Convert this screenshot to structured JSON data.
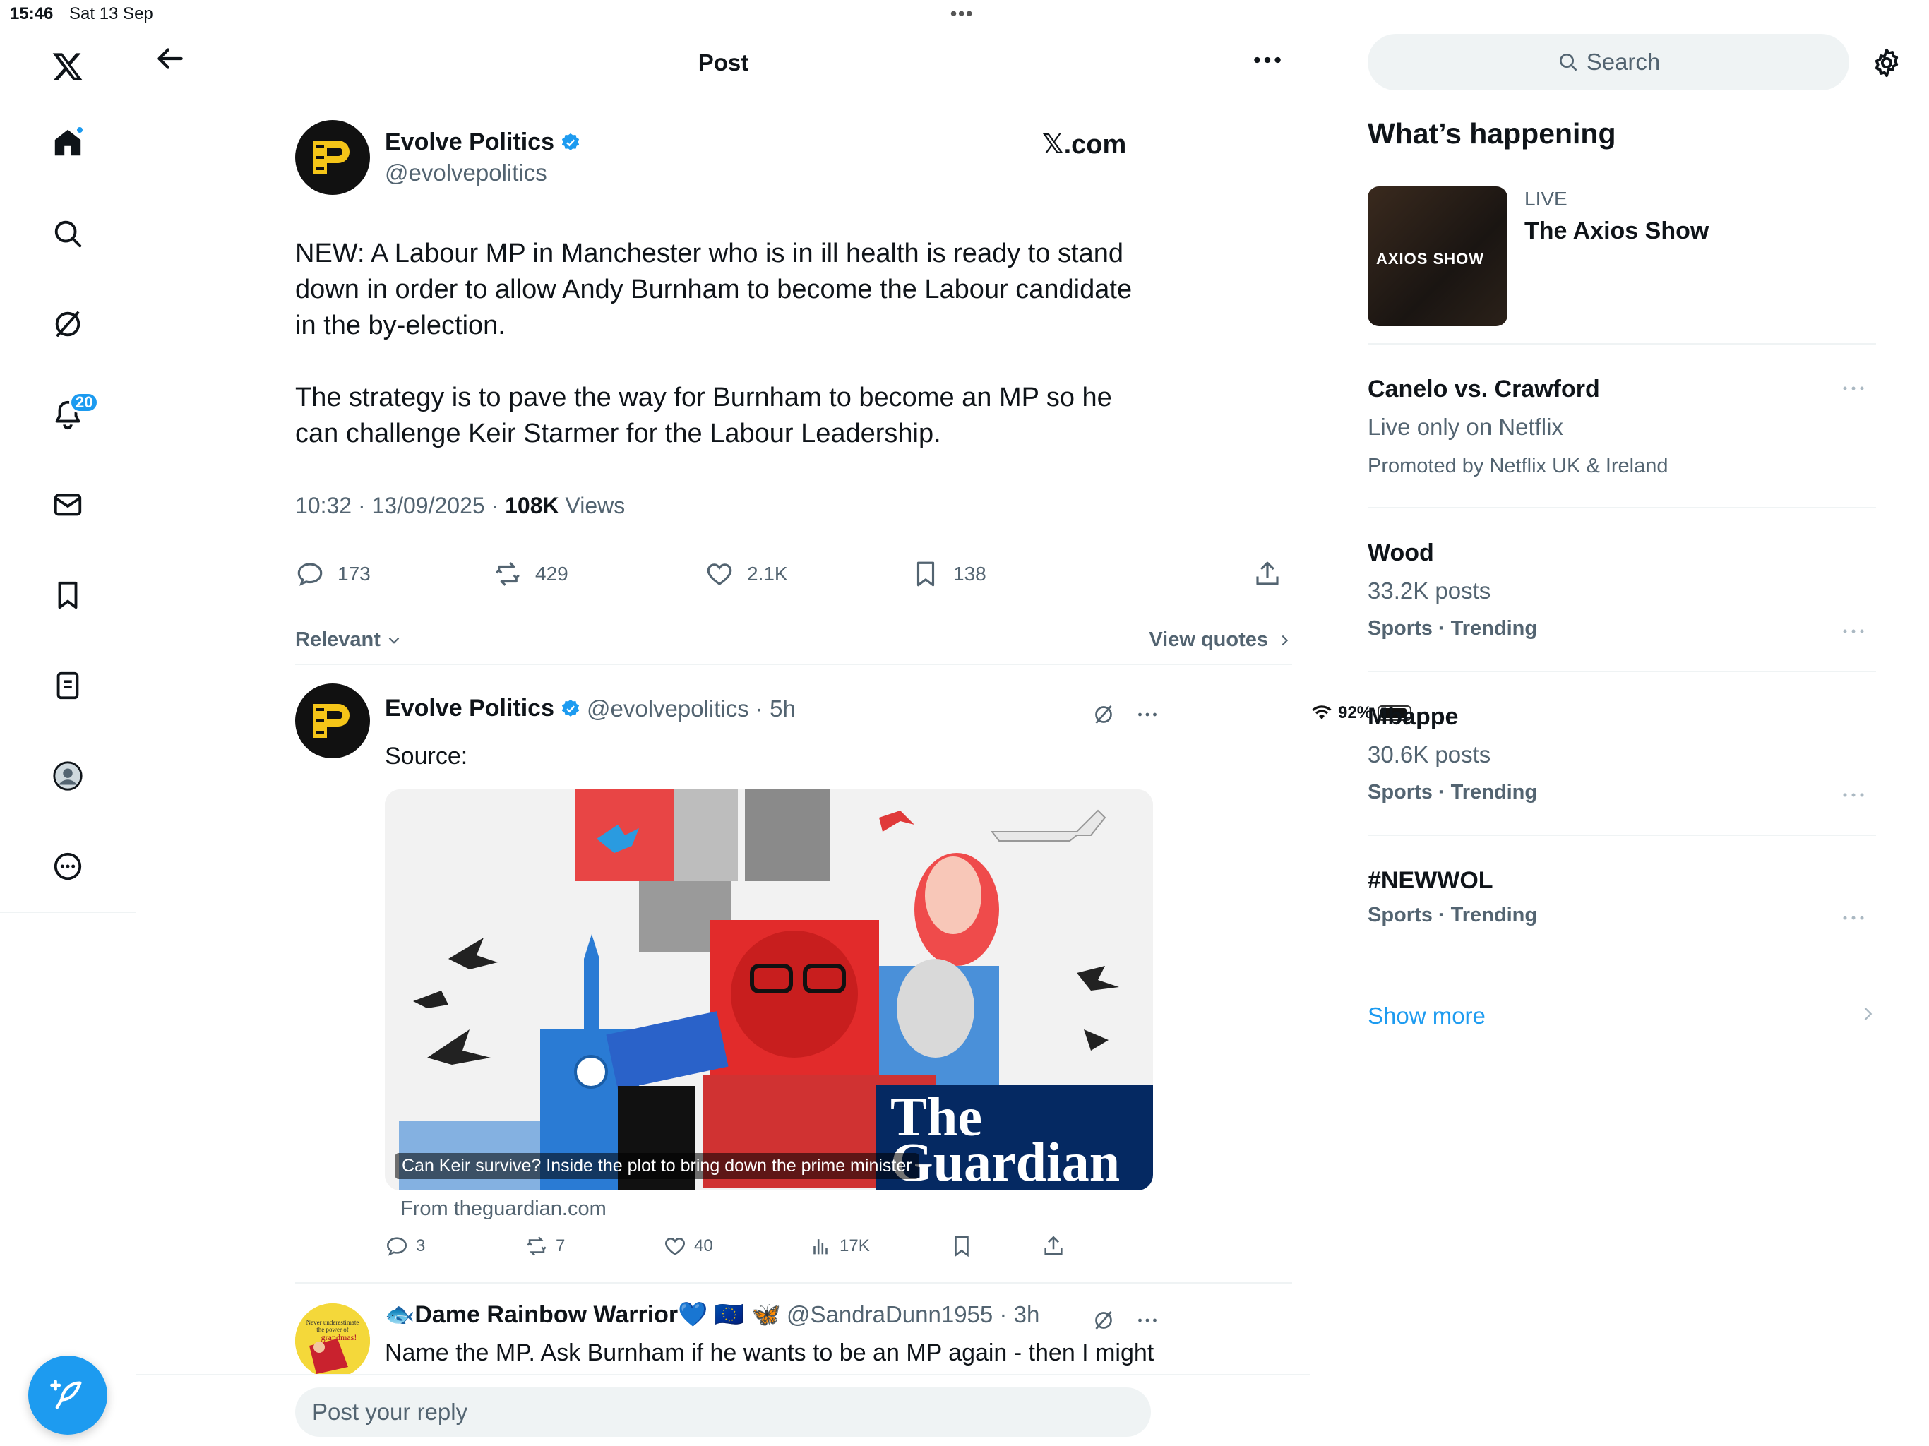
{
  "status_bar": {
    "time": "15:46",
    "date": "Sat 13 Sep",
    "battery": "92%",
    "battery_level": 0.92
  },
  "nav": {
    "icons": [
      "x-logo-icon",
      "home-icon",
      "search-icon",
      "grok-icon",
      "bell-icon",
      "mail-icon",
      "bookmark-icon",
      "lists-icon",
      "profile-icon",
      "more-circle-icon"
    ],
    "notifications_badge": "20",
    "compose_icon": "feather-plus-icon"
  },
  "header": {
    "title": "Post"
  },
  "post": {
    "author_name": "Evolve Politics",
    "author_handle": "@evolvepolitics",
    "source_label": "𝕏.com",
    "paragraphs": [
      "NEW: A Labour MP in Manchester who is in ill health is ready to stand down in order to allow Andy Burnham to become the Labour candidate in the by-election.",
      "The strategy is to pave the way for Burnham to become an MP so he can challenge Keir Starmer for the Labour Leadership."
    ],
    "timestamp": "10:32 · 13/09/2025 · ",
    "views_count": "108K",
    "views_label": " Views",
    "stats": {
      "replies": "173",
      "reposts": "429",
      "likes": "2.1K",
      "bookmarks": "138"
    }
  },
  "sort": {
    "relevant_label": "Relevant",
    "view_quotes_label": "View quotes"
  },
  "replies": [
    {
      "author_name": "Evolve Politics",
      "handle_time": "@evolvepolitics · 5h",
      "text": "Source:",
      "card": {
        "brand": "The Guardian",
        "caption": "Can Keir survive? Inside the plot to bring down the prime minister",
        "from": "From theguardian.com"
      },
      "stats": {
        "replies": "3",
        "reposts": "7",
        "likes": "40",
        "views": "17K"
      }
    },
    {
      "author_name": "🐟Dame Rainbow Warrior💙 🇪🇺 🦋",
      "handle_time": "@SandraDunn1955 · 3h",
      "text": "Name the MP. Ask Burnham if he wants to be an MP again - then I might believe you. Personally, I like AB but he couldn't even beat Ed Milliband!",
      "avatar_lines": [
        "Never underestimate",
        "the power of",
        "grandmas!"
      ]
    }
  ],
  "reply_bar": {
    "placeholder": "Post your reply"
  },
  "sidebar": {
    "search_placeholder": "Search",
    "whats_happening": "What’s happening",
    "live": {
      "label": "LIVE",
      "title": "The Axios Show",
      "thumb_text": "AXIOS SHOW"
    },
    "trends": [
      {
        "title": "Canelo vs. Crawford",
        "sub": "Live only on Netflix",
        "meta": "Promoted by Netflix UK & Ireland"
      },
      {
        "title": "Wood",
        "sub": "33.2K posts",
        "meta": "Sports · Trending"
      },
      {
        "title": "Mbappe",
        "sub": "30.6K posts",
        "meta": "Sports · Trending"
      },
      {
        "title": "#NEWWOL",
        "sub": "",
        "meta": "Sports · Trending"
      }
    ],
    "show_more": "Show more"
  }
}
